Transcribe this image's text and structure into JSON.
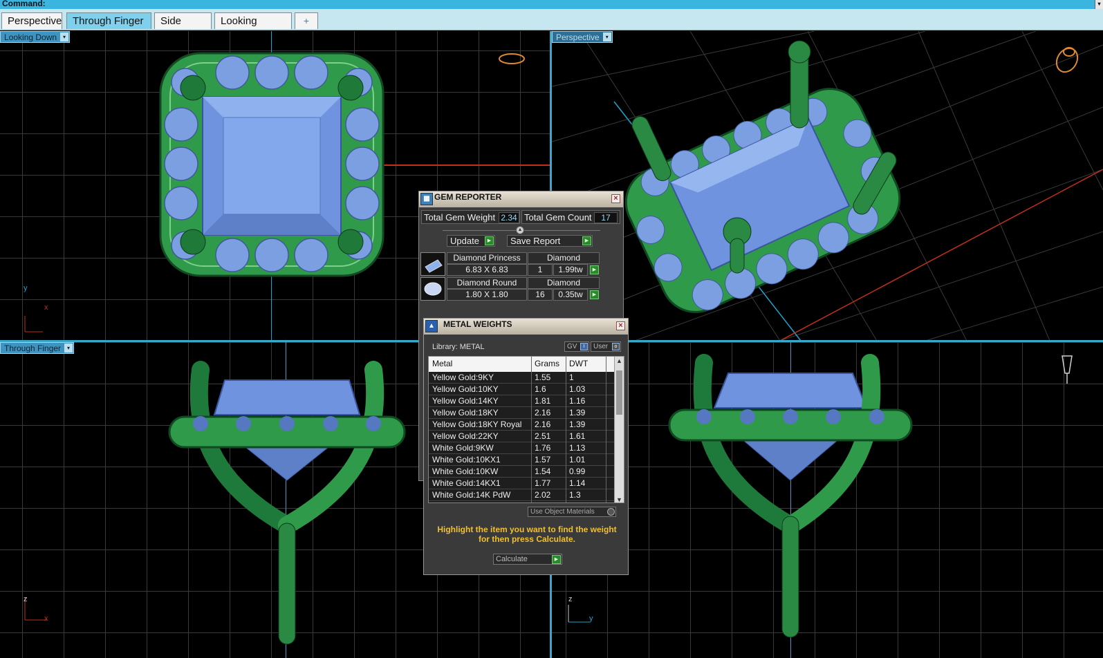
{
  "command_bar": {
    "label": "Command:"
  },
  "tabs": [
    {
      "label": "Perspective",
      "active": false
    },
    {
      "label": "Through Finger",
      "active": true
    },
    {
      "label": "Side View",
      "active": false
    },
    {
      "label": "Looking Down",
      "active": false
    },
    {
      "label": "+",
      "active": false
    }
  ],
  "viewports": {
    "top_left": {
      "label": "Looking Down",
      "axis_v": "y",
      "axis_h": "x"
    },
    "top_right": {
      "label": "Perspective"
    },
    "bottom_left": {
      "label": "Through Finger",
      "axis_v": "z",
      "axis_h": "x"
    },
    "bottom_right": {
      "axis_v": "z",
      "axis_h": "y"
    }
  },
  "gem_reporter": {
    "title": "GEM REPORTER",
    "total_gem_weight_label": "Total Gem Weight",
    "total_gem_weight": "2.34",
    "total_gem_count_label": "Total Gem Count",
    "total_gem_count": "17",
    "update_label": "Update",
    "save_report_label": "Save Report",
    "gems": [
      {
        "name": "Diamond Princess",
        "size": "6.83 X 6.83",
        "material": "Diamond",
        "count": "1",
        "weight": "1.99tw"
      },
      {
        "name": "Diamond Round",
        "size": "1.80 X 1.80",
        "material": "Diamond",
        "count": "16",
        "weight": "0.35tw"
      }
    ]
  },
  "metal_weights": {
    "title": "METAL WEIGHTS",
    "library_label": "Library: METAL",
    "gv_label": "GV",
    "user_label": "User",
    "columns": [
      "Metal",
      "Grams",
      "DWT"
    ],
    "rows": [
      [
        "Yellow Gold:9KY",
        "1.55",
        "1"
      ],
      [
        "Yellow Gold:10KY",
        "1.6",
        "1.03"
      ],
      [
        "Yellow Gold:14KY",
        "1.81",
        "1.16"
      ],
      [
        "Yellow Gold:18KY",
        "2.16",
        "1.39"
      ],
      [
        "Yellow Gold:18KY Royal",
        "2.16",
        "1.39"
      ],
      [
        "Yellow Gold:22KY",
        "2.51",
        "1.61"
      ],
      [
        "White Gold:9KW",
        "1.76",
        "1.13"
      ],
      [
        "White Gold:10KX1",
        "1.57",
        "1.01"
      ],
      [
        "White Gold:10KW",
        "1.54",
        "0.99"
      ],
      [
        "White Gold:14KX1",
        "1.77",
        "1.14"
      ],
      [
        "White Gold:14K PdW",
        "2.02",
        "1.3"
      ]
    ],
    "use_object_materials_label": "Use Object Materials",
    "hint": "Highlight the item you want to find the weight for then press Calculate.",
    "calculate_label": "Calculate"
  },
  "colors": {
    "metal_green": "#2f9a4a",
    "gem_blue": "#7b9fe0",
    "accent": "#3ab5e0"
  }
}
